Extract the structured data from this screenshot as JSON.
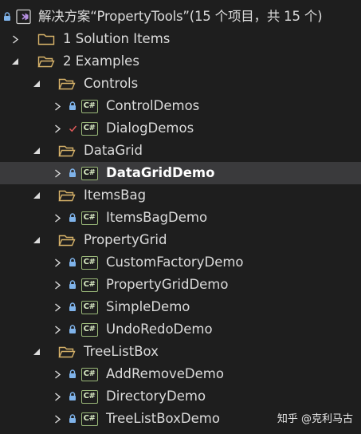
{
  "solution": {
    "title": "解决方案“PropertyTools”(15 个项目，共 15 个)"
  },
  "items": [
    {
      "label": "1 Solution Items"
    },
    {
      "label": "2 Examples"
    },
    {
      "label": "Controls"
    },
    {
      "label": "ControlDemos"
    },
    {
      "label": "DialogDemos"
    },
    {
      "label": "DataGrid"
    },
    {
      "label": "DataGridDemo"
    },
    {
      "label": "ItemsBag"
    },
    {
      "label": "ItemsBagDemo"
    },
    {
      "label": "PropertyGrid"
    },
    {
      "label": "CustomFactoryDemo"
    },
    {
      "label": "PropertyGridDemo"
    },
    {
      "label": "SimpleDemo"
    },
    {
      "label": "UndoRedoDemo"
    },
    {
      "label": "TreeListBox"
    },
    {
      "label": "AddRemoveDemo"
    },
    {
      "label": "DirectoryDemo"
    },
    {
      "label": "TreeListBoxDemo"
    }
  ],
  "project_icon_text": "C#",
  "watermark": "知乎 @克利马古",
  "colors": {
    "background": "#1e1e1e",
    "text": "#dcdcdc",
    "selection": "#3a3a3c",
    "folder": "#d9b46a",
    "lock": "#7fb3ea",
    "check": "#e05a5a",
    "csharp_border": "#9ab879",
    "solution_icon": "#b48ee0"
  },
  "icons": {
    "solution": "visual-studio-solution-icon",
    "folder_closed": "folder-icon",
    "folder_open": "folder-open-icon",
    "project": "csharp-project-icon",
    "lock": "lock-icon",
    "check": "checkmark-icon",
    "collapsed": "chevron-right-icon",
    "expanded": "chevron-down-icon"
  }
}
